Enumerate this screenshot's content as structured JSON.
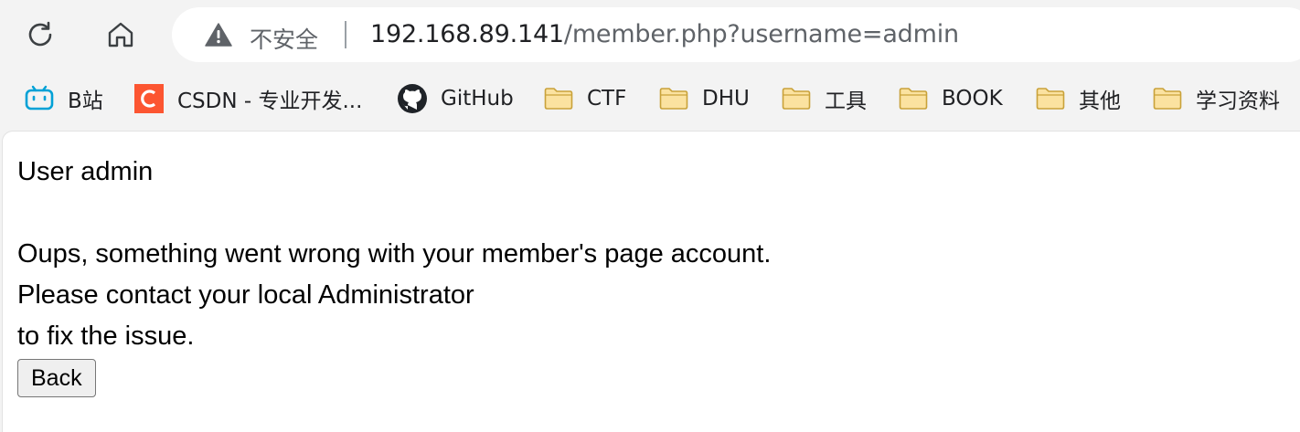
{
  "toolbar": {
    "reload_icon": "reload-icon",
    "home_icon": "home-icon"
  },
  "address_bar": {
    "security_icon": "warning-triangle-icon",
    "security_label": "不安全",
    "url_host": "192.168.89.141",
    "url_path": "/member.php?username=admin"
  },
  "bookmarks": [
    {
      "label": "B站",
      "icon": "bilibili-icon"
    },
    {
      "label": "CSDN - 专业开发...",
      "icon": "csdn-icon"
    },
    {
      "label": "GitHub",
      "icon": "github-icon"
    },
    {
      "label": "CTF",
      "icon": "folder-icon"
    },
    {
      "label": "DHU",
      "icon": "folder-icon"
    },
    {
      "label": "工具",
      "icon": "folder-icon"
    },
    {
      "label": "BOOK",
      "icon": "folder-icon"
    },
    {
      "label": "其他",
      "icon": "folder-icon"
    },
    {
      "label": "学习资料",
      "icon": "folder-icon"
    }
  ],
  "colors": {
    "chrome_bg": "#f3f3f3",
    "bilibili": "#00a1d6",
    "csdn": "#fc5531",
    "folder_fill": "#fbe2a0",
    "folder_stroke": "#c9a23a"
  },
  "page": {
    "heading": "User admin",
    "line1": "Oups, something went wrong with your member's page account.",
    "line2": "Please contact your local Administrator",
    "line3": "to fix the issue.",
    "back_label": "Back"
  }
}
